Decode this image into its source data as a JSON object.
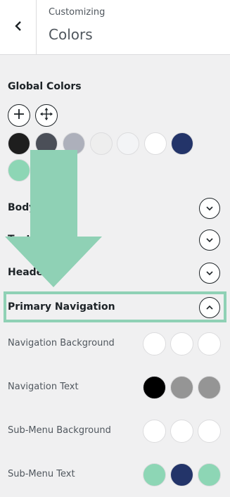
{
  "header": {
    "breadcrumb": "Customizing",
    "title": "Colors",
    "back_icon": "chevron-left-icon"
  },
  "global_colors": {
    "title": "Global Colors",
    "add_icon": "plus-icon",
    "move_icon": "move-arrows-icon",
    "swatches": [
      "#1e1e1e",
      "#4b4f58",
      "#adb0bb",
      "#eeeeee",
      "#f3f4f6",
      "#ffffff",
      "#233469",
      "#8dd6b5"
    ]
  },
  "groups": [
    {
      "label": "Body",
      "state": "collapsed"
    },
    {
      "label": "Text",
      "state": "collapsed"
    },
    {
      "label": "Header",
      "state": "collapsed"
    },
    {
      "label": "Primary Navigation",
      "state": "expanded"
    }
  ],
  "primary_navigation": {
    "rows": [
      {
        "label": "Navigation Background",
        "colors": [
          "#ffffff",
          "#ffffff",
          "#ffffff"
        ]
      },
      {
        "label": "Navigation Text",
        "colors": [
          "#000000",
          "#959595",
          "#959595"
        ]
      },
      {
        "label": "Sub-Menu Background",
        "colors": [
          "#ffffff",
          "#ffffff",
          "#ffffff"
        ]
      },
      {
        "label": "Sub-Menu Text",
        "colors": [
          "#8dd6b5",
          "#233469",
          "#8dd6b5"
        ]
      }
    ]
  },
  "annotation": {
    "arrow_color": "#8fd1b5",
    "highlight_color": "#8fd1b5"
  }
}
